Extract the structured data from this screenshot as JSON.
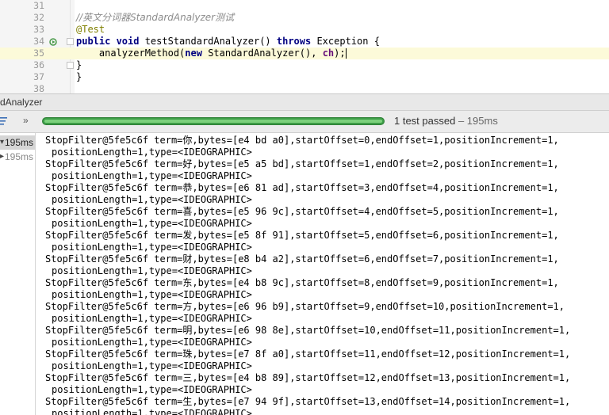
{
  "editor": {
    "lines": [
      {
        "no": "31",
        "segments": []
      },
      {
        "no": "32",
        "segments": [
          {
            "cls": "cm",
            "text": "//英文分词器StandardAnalyzer测试"
          }
        ]
      },
      {
        "no": "33",
        "segments": [
          {
            "cls": "ann",
            "text": "@Test"
          }
        ]
      },
      {
        "no": "34",
        "segments": [
          {
            "cls": "kw",
            "text": "public void "
          },
          {
            "cls": "",
            "text": "testStandardAnalyzer() "
          },
          {
            "cls": "kw",
            "text": "throws "
          },
          {
            "cls": "",
            "text": "Exception {"
          }
        ]
      },
      {
        "no": "35",
        "current": true,
        "segments": [
          {
            "cls": "",
            "text": "    analyzerMethod("
          },
          {
            "cls": "kw",
            "text": "new "
          },
          {
            "cls": "",
            "text": "StandardAnalyzer(), "
          },
          {
            "cls": "ch",
            "text": "ch"
          },
          {
            "cls": "",
            "text": ");"
          }
        ]
      },
      {
        "no": "36",
        "segments": [
          {
            "cls": "",
            "text": "}"
          }
        ]
      },
      {
        "no": "37",
        "segments": [
          {
            "cls": "",
            "text": "}"
          }
        ]
      },
      {
        "no": "38",
        "segments": []
      }
    ],
    "icons": {
      "run": "run-test-icon",
      "fold": "fold-marker-icon"
    }
  },
  "panel": {
    "title": "dAnalyzer"
  },
  "toolbar": {
    "more_label": "»",
    "progress": 1.0,
    "status_text": "1 test passed",
    "status_sep": " – ",
    "status_duration": "195ms",
    "colors": {
      "progress": "#3e9e48",
      "progress_highlight": "#7cd17c"
    }
  },
  "tree": {
    "items": [
      {
        "time": "195ms",
        "selected": true,
        "expanded": true
      },
      {
        "time": "195ms",
        "selected": false,
        "expanded": false
      }
    ]
  },
  "output": {
    "entries": [
      {
        "line1": "StopFilter@5fe5c6f term=你,bytes=[e4 bd a0],startOffset=0,endOffset=1,positionIncrement=1,",
        "line2": "positionLength=1,type=<IDEOGRAPHIC>"
      },
      {
        "line1": "StopFilter@5fe5c6f term=好,bytes=[e5 a5 bd],startOffset=1,endOffset=2,positionIncrement=1,",
        "line2": "positionLength=1,type=<IDEOGRAPHIC>"
      },
      {
        "line1": "StopFilter@5fe5c6f term=恭,bytes=[e6 81 ad],startOffset=3,endOffset=4,positionIncrement=1,",
        "line2": "positionLength=1,type=<IDEOGRAPHIC>"
      },
      {
        "line1": "StopFilter@5fe5c6f term=喜,bytes=[e5 96 9c],startOffset=4,endOffset=5,positionIncrement=1,",
        "line2": "positionLength=1,type=<IDEOGRAPHIC>"
      },
      {
        "line1": "StopFilter@5fe5c6f term=发,bytes=[e5 8f 91],startOffset=5,endOffset=6,positionIncrement=1,",
        "line2": "positionLength=1,type=<IDEOGRAPHIC>"
      },
      {
        "line1": "StopFilter@5fe5c6f term=财,bytes=[e8 b4 a2],startOffset=6,endOffset=7,positionIncrement=1,",
        "line2": "positionLength=1,type=<IDEOGRAPHIC>"
      },
      {
        "line1": "StopFilter@5fe5c6f term=东,bytes=[e4 b8 9c],startOffset=8,endOffset=9,positionIncrement=1,",
        "line2": "positionLength=1,type=<IDEOGRAPHIC>"
      },
      {
        "line1": "StopFilter@5fe5c6f term=方,bytes=[e6 96 b9],startOffset=9,endOffset=10,positionIncrement=1,",
        "line2": "positionLength=1,type=<IDEOGRAPHIC>"
      },
      {
        "line1": "StopFilter@5fe5c6f term=明,bytes=[e6 98 8e],startOffset=10,endOffset=11,positionIncrement=1,",
        "line2": "positionLength=1,type=<IDEOGRAPHIC>"
      },
      {
        "line1": "StopFilter@5fe5c6f term=珠,bytes=[e7 8f a0],startOffset=11,endOffset=12,positionIncrement=1,",
        "line2": "positionLength=1,type=<IDEOGRAPHIC>"
      },
      {
        "line1": "StopFilter@5fe5c6f term=三,bytes=[e4 b8 89],startOffset=12,endOffset=13,positionIncrement=1,",
        "line2": "positionLength=1,type=<IDEOGRAPHIC>"
      },
      {
        "line1": "StopFilter@5fe5c6f term=生,bytes=[e7 94 9f],startOffset=13,endOffset=14,positionIncrement=1,",
        "line2": "positionLength=1,type=<IDEOGRAPHIC>"
      }
    ]
  }
}
